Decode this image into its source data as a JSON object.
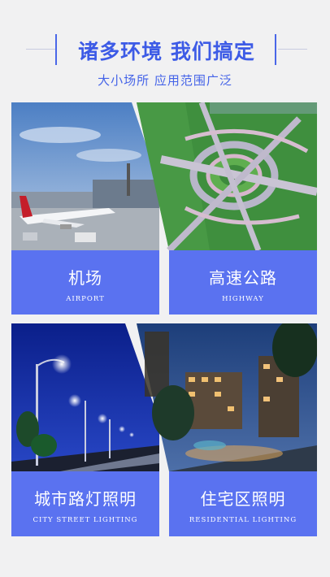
{
  "header": {
    "title": "诸多环境 我们搞定",
    "subtitle": "大小场所 应用范围广泛"
  },
  "cards": [
    {
      "title": "机场",
      "subtitle": "AIRPORT"
    },
    {
      "title": "高速公路",
      "subtitle": "HIGHWAY"
    },
    {
      "title": "城市路灯照明",
      "subtitle": "CITY STREET LIGHTING"
    },
    {
      "title": "住宅区照明",
      "subtitle": "RESIDENTIAL  LIGHTING"
    }
  ],
  "colors": {
    "accent": "#4a67e8",
    "label_bg": "#5a72f0",
    "page_bg": "#f1f1f2"
  }
}
